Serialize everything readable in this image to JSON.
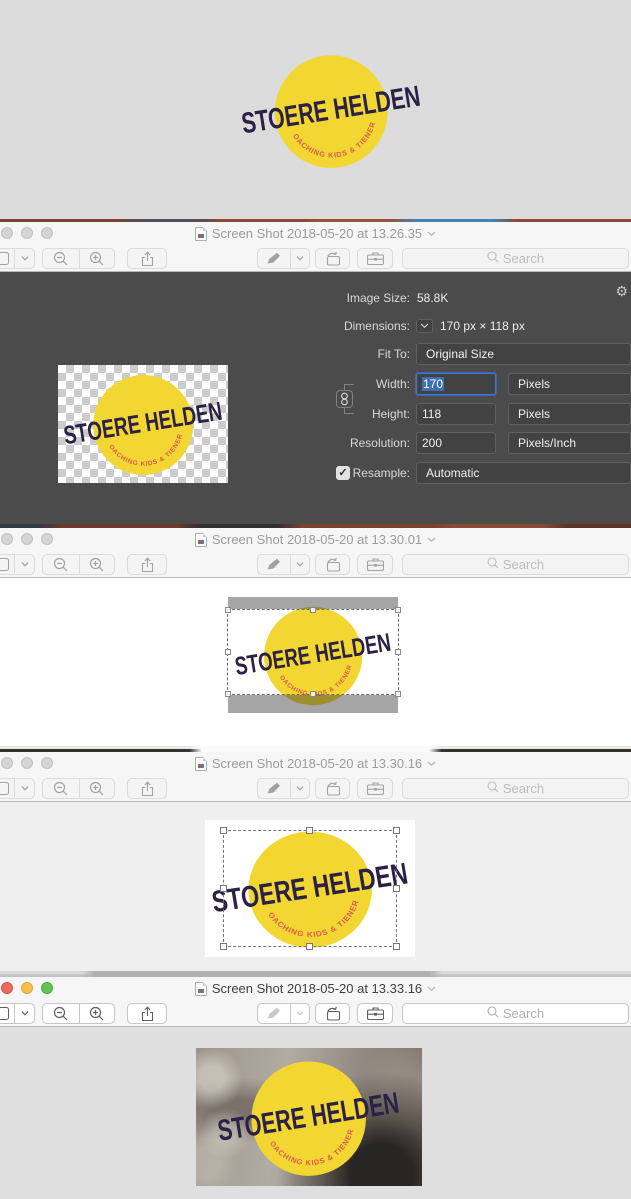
{
  "logo": {
    "title": "STOERE HELDEN",
    "subtitle": "COACHING KIDS & TIENERS",
    "circle_color": "#f2d733",
    "title_color": "#2b2145",
    "subtitle_color": "#e0584e"
  },
  "search": {
    "placeholder": "Search"
  },
  "windows": [
    {
      "title": "Screen Shot 2018-05-20 at 13.26.35",
      "active": false
    },
    {
      "title": "Screen Shot 2018-05-20 at 13.30.01",
      "active": false
    },
    {
      "title": "Screen Shot 2018-05-20 at 13.30.16",
      "active": false
    },
    {
      "title": "Screen Shot 2018-05-20 at 13.33.16",
      "active": true
    }
  ],
  "inspector": {
    "image_size_label": "Image Size:",
    "image_size_value": "58.8K",
    "dimensions_label": "Dimensions:",
    "dimensions_value": "170 px  ×  118 px",
    "fit_to_label": "Fit To:",
    "fit_to_value": "Original Size",
    "width_label": "Width:",
    "width_value": "170",
    "width_unit": "Pixels",
    "height_label": "Height:",
    "height_value": "118",
    "height_unit": "Pixels",
    "resolution_label": "Resolution:",
    "resolution_value": "200",
    "resolution_unit": "Pixels/Inch",
    "resample_label": "Resample:",
    "resample_value": "Automatic",
    "resample_checked": true,
    "checkmark": "✓"
  }
}
